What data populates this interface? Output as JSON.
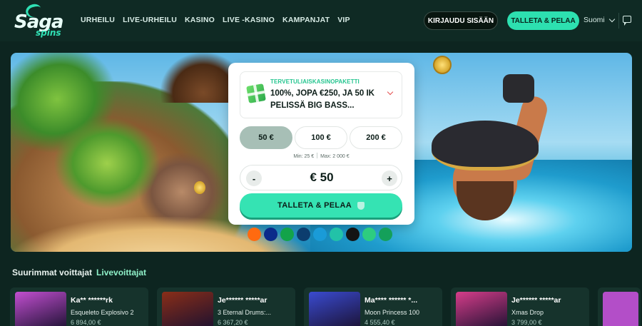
{
  "header": {
    "logo_main": "Saga",
    "logo_sub": "spins",
    "nav": [
      "URHEILU",
      "LIVE-URHEILU",
      "KASINO",
      "LIVE -KASINO",
      "KAMPANJAT",
      "VIP"
    ],
    "login_label": "KIRJAUDU SISÄÄN",
    "deposit_label": "TALLETA & PELAA",
    "language": "Suomi",
    "chat_icon": "chat-icon"
  },
  "deposit": {
    "promo_tag": "TERVETULIAISKASINOPAKETTI",
    "promo_text": "100%, JOPA €250, JA 50 IK PELISSÄ BIG BASS...",
    "amounts": [
      "50 €",
      "100 €",
      "200 €"
    ],
    "selected_amount": "50 €",
    "min_label": "Min: 25 €",
    "max_label": "Max: 2 000 €",
    "minus": "-",
    "plus": "+",
    "value": "€ 50",
    "play_label": "TALLETA & PELAA"
  },
  "payments": [
    {
      "name": "op",
      "color": "#ff6a10"
    },
    {
      "name": "nordea",
      "color": "#0b2a8a"
    },
    {
      "name": "s-pankki",
      "color": "#13a34a"
    },
    {
      "name": "danske",
      "color": "#0c3d6e"
    },
    {
      "name": "handelsbanken",
      "color": "#1a9bd7"
    },
    {
      "name": "POP",
      "color": "#22c2a8"
    },
    {
      "name": "aktia",
      "color": "#141414"
    },
    {
      "name": "alandsbanken",
      "color": "#2dcd80"
    },
    {
      "name": "a-icon",
      "color": "#14a05a"
    }
  ],
  "winners": {
    "title": "Suurimmat voittajat",
    "live_label": "Livevoittajat",
    "items": [
      {
        "user": "Ka** ******rk",
        "game": "Esqueleto Explosivo 2",
        "amount": "6 894,00 €",
        "color": "#c24fd0"
      },
      {
        "user": "Je****** *****ar",
        "game": "3 Eternal Drums:...",
        "amount": "6 367,20 €",
        "color": "#8a2e18"
      },
      {
        "user": "Ma**** ****** *...",
        "game": "Moon Princess 100",
        "amount": "4 555,40 €",
        "color": "#3a4bd0"
      },
      {
        "user": "Je****** *****ar",
        "game": "Xmas Drop",
        "amount": "3 799,00 €",
        "color": "#d63d8a"
      }
    ]
  }
}
